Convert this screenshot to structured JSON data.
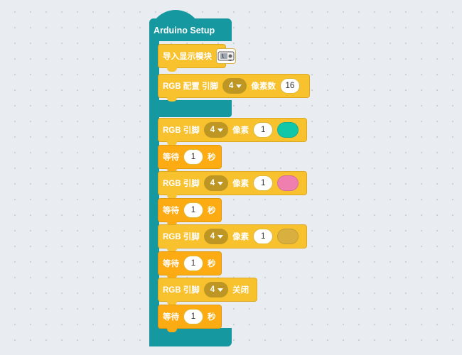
{
  "hat": {
    "title": "Arduino Setup"
  },
  "colors": {
    "hat": "#1598a0",
    "block_yellow": "#f8c22f",
    "block_orange": "#fdab13",
    "dropdown": "#bd9624"
  },
  "blocks": {
    "import_display": {
      "label": "导入显示模块",
      "icon": "display-module-icon"
    },
    "rgb_config": {
      "label": "RGB 配置 引脚",
      "pin": "4",
      "pixels_label": "像素数",
      "pixels": "16"
    },
    "rgb_set_1": {
      "label": "RGB 引脚",
      "pin": "4",
      "pixel_label": "像素",
      "pixel": "1",
      "color": "#10c8a8"
    },
    "wait_1": {
      "label": "等待",
      "value": "1",
      "unit": "秒"
    },
    "rgb_set_2": {
      "label": "RGB 引脚",
      "pin": "4",
      "pixel_label": "像素",
      "pixel": "1",
      "color": "#ef7fae"
    },
    "wait_2": {
      "label": "等待",
      "value": "1",
      "unit": "秒"
    },
    "rgb_set_3": {
      "label": "RGB 引脚",
      "pin": "4",
      "pixel_label": "像素",
      "pixel": "1",
      "color": "#d9b040"
    },
    "wait_3": {
      "label": "等待",
      "value": "1",
      "unit": "秒"
    },
    "rgb_off": {
      "label": "RGB 引脚",
      "pin": "4",
      "action": "关闭"
    },
    "wait_4": {
      "label": "等待",
      "value": "1",
      "unit": "秒"
    }
  }
}
